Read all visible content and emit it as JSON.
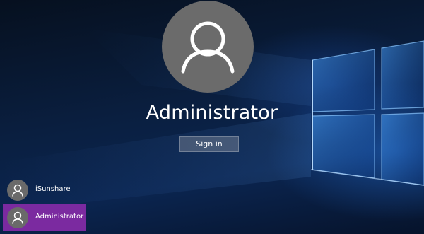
{
  "login": {
    "username": "Administrator",
    "sign_in_label": "Sign in"
  },
  "user_list": {
    "items": [
      {
        "label": "iSunshare",
        "selected": false
      },
      {
        "label": "Administrator",
        "selected": true
      }
    ]
  },
  "colors": {
    "selected_user": "#7b2aa0",
    "avatar_bg": "#6b6b6b",
    "wallpaper_accent": "#2a78e6"
  },
  "icons": {
    "avatar": "person-outline-icon"
  }
}
